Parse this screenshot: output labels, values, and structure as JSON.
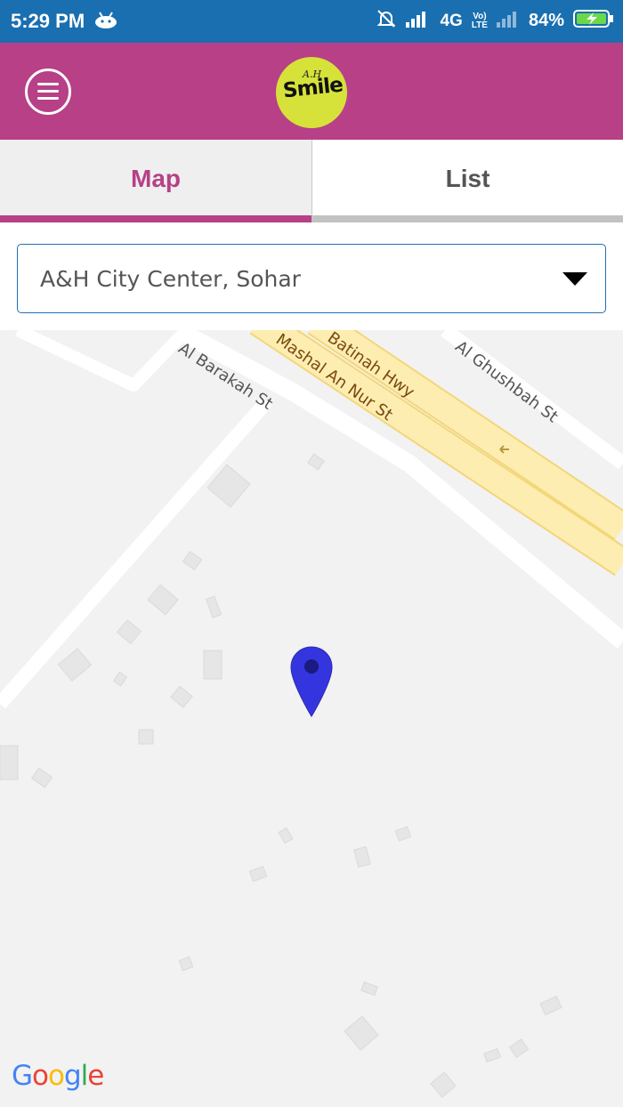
{
  "status_bar": {
    "time": "5:29 PM",
    "network": "4G",
    "volte_line1": "Vo)",
    "volte_line2": "LTE",
    "battery": "84%"
  },
  "header": {
    "logo_small": "A.H",
    "logo_main": "Smile"
  },
  "tabs": [
    {
      "label": "Map",
      "active": true
    },
    {
      "label": "List",
      "active": false
    }
  ],
  "location_select": {
    "selected": "A&H City Center, Sohar"
  },
  "map": {
    "streets": {
      "al_barakah": "Al Barakah St",
      "batinah": "Batinah Hwy",
      "mashal": "Mashal An Nur St",
      "al_ghushbah": "Al Ghushbah St"
    },
    "attribution": "Google",
    "pin_color": "#3535e0"
  },
  "colors": {
    "status_bar": "#1a6fb0",
    "app_bar": "#b74087",
    "accent": "#b74087",
    "highway": "#fdedb0"
  }
}
